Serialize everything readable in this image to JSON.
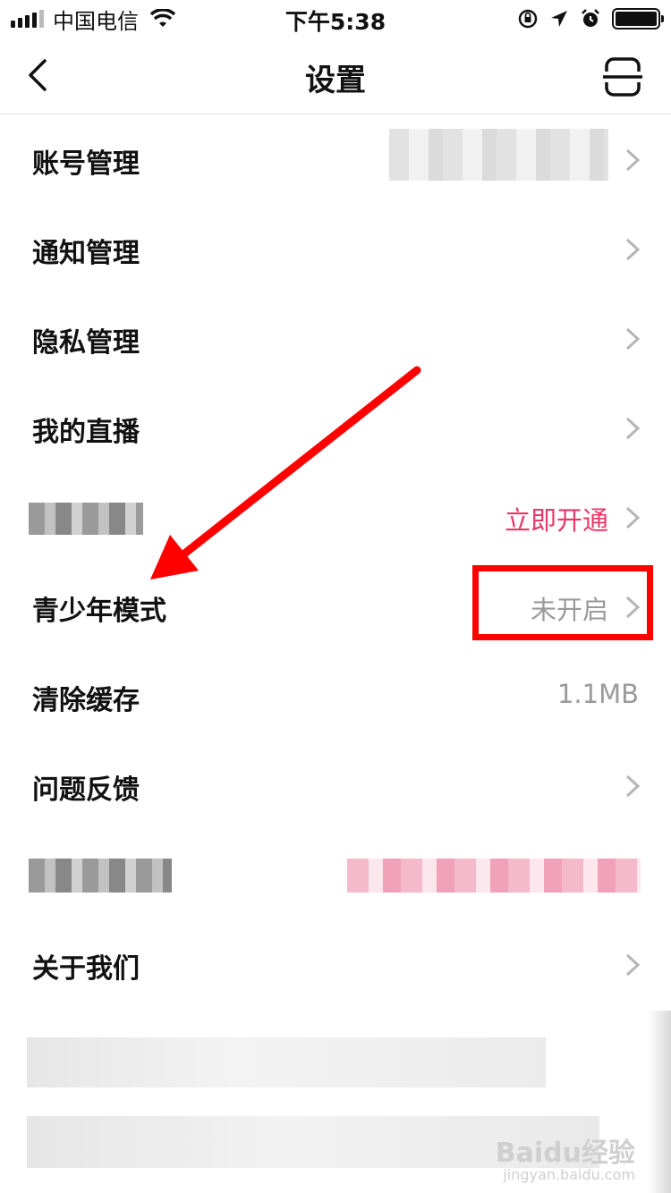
{
  "status_bar": {
    "carrier": "中国电信",
    "time": "下午5:38"
  },
  "nav": {
    "title": "设置"
  },
  "rows": [
    {
      "label": "账号管理",
      "value": ""
    },
    {
      "label": "通知管理",
      "value": ""
    },
    {
      "label": "隐私管理",
      "value": ""
    },
    {
      "label": "我的直播",
      "value": ""
    },
    {
      "label": "",
      "value": "立即开通"
    },
    {
      "label": "青少年模式",
      "value": "未开启"
    },
    {
      "label": "清除缓存",
      "value": "1.1MB"
    },
    {
      "label": "问题反馈",
      "value": ""
    },
    {
      "label": "",
      "value": ""
    },
    {
      "label": "关于我们",
      "value": ""
    }
  ],
  "colors": {
    "accent": "#e6396a",
    "annotation": "#ff0000"
  },
  "watermark": "Baidu经验",
  "watermark_sub": "jingyan.baidu.com"
}
